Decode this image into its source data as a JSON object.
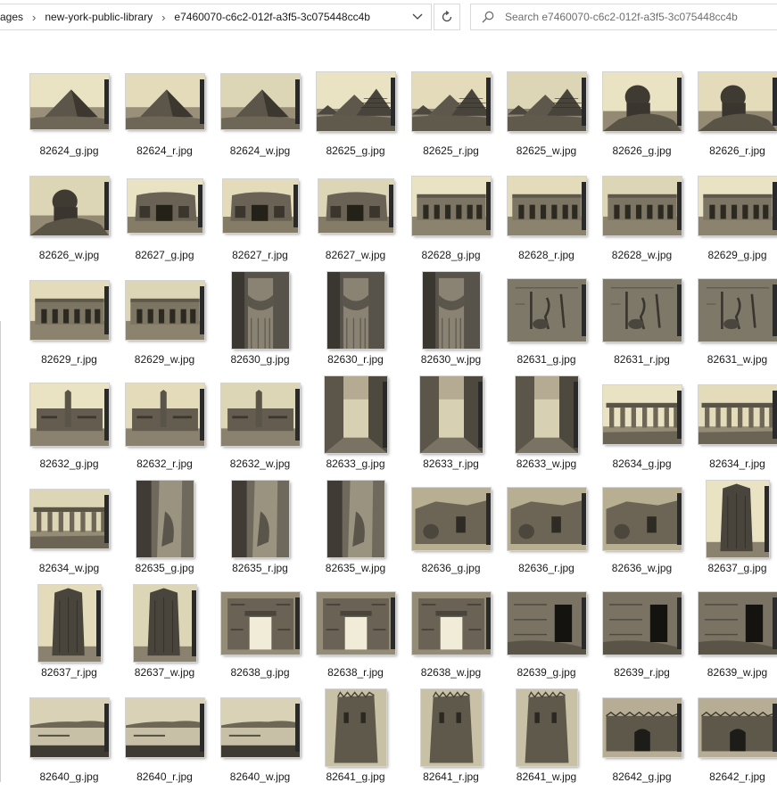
{
  "address_bar": {
    "breadcrumbs": [
      "ages",
      "new-york-public-library",
      "e7460070-c6c2-012f-a3f5-3c075448cc4b"
    ],
    "dropdown_icon": "chevron-down-icon",
    "refresh_icon": "refresh-icon"
  },
  "search": {
    "placeholder": "Search e7460070-c6c2-012f-a3f5-3c075448cc4b",
    "icon": "search-icon"
  },
  "files": [
    {
      "name": "82624_g.jpg",
      "subject": "pyramid"
    },
    {
      "name": "82624_r.jpg",
      "subject": "pyramid"
    },
    {
      "name": "82624_w.jpg",
      "subject": "pyramid"
    },
    {
      "name": "82625_g.jpg",
      "subject": "pyramids"
    },
    {
      "name": "82625_r.jpg",
      "subject": "pyramids"
    },
    {
      "name": "82625_w.jpg",
      "subject": "pyramids"
    },
    {
      "name": "82626_g.jpg",
      "subject": "sphinx"
    },
    {
      "name": "82626_r.jpg",
      "subject": "sphinx"
    },
    {
      "name": "82626_w.jpg",
      "subject": "sphinx"
    },
    {
      "name": "82627_g.jpg",
      "subject": "ruin-entrance"
    },
    {
      "name": "82627_r.jpg",
      "subject": "ruin-entrance"
    },
    {
      "name": "82627_w.jpg",
      "subject": "ruin-entrance"
    },
    {
      "name": "82628_g.jpg",
      "subject": "temple-facade"
    },
    {
      "name": "82628_r.jpg",
      "subject": "temple-facade"
    },
    {
      "name": "82628_w.jpg",
      "subject": "temple-facade"
    },
    {
      "name": "82629_g.jpg",
      "subject": "temple-facade"
    },
    {
      "name": "82629_r.jpg",
      "subject": "temple-facade"
    },
    {
      "name": "82629_w.jpg",
      "subject": "temple-facade"
    },
    {
      "name": "82630_g.jpg",
      "subject": "column"
    },
    {
      "name": "82630_r.jpg",
      "subject": "column"
    },
    {
      "name": "82630_w.jpg",
      "subject": "column"
    },
    {
      "name": "82631_g.jpg",
      "subject": "relief"
    },
    {
      "name": "82631_r.jpg",
      "subject": "relief"
    },
    {
      "name": "82631_w.jpg",
      "subject": "relief"
    },
    {
      "name": "82632_g.jpg",
      "subject": "obelisk-temple"
    },
    {
      "name": "82632_r.jpg",
      "subject": "obelisk-temple"
    },
    {
      "name": "82632_w.jpg",
      "subject": "obelisk-temple"
    },
    {
      "name": "82633_g.jpg",
      "subject": "corridor"
    },
    {
      "name": "82633_r.jpg",
      "subject": "corridor"
    },
    {
      "name": "82633_w.jpg",
      "subject": "corridor"
    },
    {
      "name": "82634_g.jpg",
      "subject": "colonnade"
    },
    {
      "name": "82634_r.jpg",
      "subject": "colonnade"
    },
    {
      "name": "82634_w.jpg",
      "subject": "colonnade"
    },
    {
      "name": "82635_g.jpg",
      "subject": "statue-pillar"
    },
    {
      "name": "82635_r.jpg",
      "subject": "statue-pillar"
    },
    {
      "name": "82635_w.jpg",
      "subject": "statue-pillar"
    },
    {
      "name": "82636_g.jpg",
      "subject": "ruin-wall"
    },
    {
      "name": "82636_r.jpg",
      "subject": "ruin-wall"
    },
    {
      "name": "82636_w.jpg",
      "subject": "ruin-wall"
    },
    {
      "name": "82637_g.jpg",
      "subject": "obelisk"
    },
    {
      "name": "82637_r.jpg",
      "subject": "obelisk"
    },
    {
      "name": "82637_w.jpg",
      "subject": "obelisk"
    },
    {
      "name": "82638_g.jpg",
      "subject": "pylon-gate"
    },
    {
      "name": "82638_r.jpg",
      "subject": "pylon-gate"
    },
    {
      "name": "82638_w.jpg",
      "subject": "pylon-gate"
    },
    {
      "name": "82639_g.jpg",
      "subject": "carved-wall"
    },
    {
      "name": "82639_r.jpg",
      "subject": "carved-wall"
    },
    {
      "name": "82639_w.jpg",
      "subject": "carved-wall"
    },
    {
      "name": "82640_g.jpg",
      "subject": "river"
    },
    {
      "name": "82640_r.jpg",
      "subject": "river"
    },
    {
      "name": "82640_w.jpg",
      "subject": "river"
    },
    {
      "name": "82641_g.jpg",
      "subject": "tower"
    },
    {
      "name": "82641_r.jpg",
      "subject": "tower"
    },
    {
      "name": "82641_w.jpg",
      "subject": "tower"
    },
    {
      "name": "82642_g.jpg",
      "subject": "city-gate"
    },
    {
      "name": "82642_r.jpg",
      "subject": "city-gate"
    }
  ]
}
